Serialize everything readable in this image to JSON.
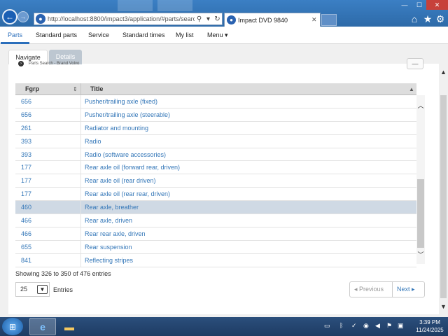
{
  "browser": {
    "url": "http://localhost:8800/impact3/application/#parts/searcl",
    "tab_title": "Impact DVD 9840",
    "tab_close": "✕",
    "back_icon": "arrow-left-icon",
    "search_glyph": "⚲",
    "refresh_glyph": "↻",
    "window_min": "—",
    "window_max": "☐",
    "window_close": "✕",
    "home_glyph": "⌂",
    "favorites_glyph": "★",
    "settings_glyph": "⚙"
  },
  "menu": {
    "items": [
      {
        "label": "Parts",
        "active": true
      },
      {
        "label": "Standard parts"
      },
      {
        "label": "Service"
      },
      {
        "label": "Standard times"
      },
      {
        "label": "My list"
      },
      {
        "label": "Menu ▾"
      }
    ]
  },
  "page_tabs": {
    "navigate": "Navigate",
    "details": "Details"
  },
  "breadcrumb": "Parts Search - Brand Volvo",
  "collapse_glyph": "—",
  "table": {
    "col1": "Fgrp",
    "col2": "Title",
    "rows": [
      {
        "fgrp": "656",
        "title": "Pusher/trailing axle (fixed)"
      },
      {
        "fgrp": "656",
        "title": "Pusher/trailing axle (steerable)"
      },
      {
        "fgrp": "261",
        "title": "Radiator and mounting"
      },
      {
        "fgrp": "393",
        "title": "Radio"
      },
      {
        "fgrp": "393",
        "title": "Radio (software accessories)"
      },
      {
        "fgrp": "177",
        "title": "Rear axle oil (forward rear, driven)"
      },
      {
        "fgrp": "177",
        "title": "Rear axle oil (rear driven)"
      },
      {
        "fgrp": "177",
        "title": "Rear axle oil (rear rear, driven)"
      },
      {
        "fgrp": "460",
        "title": "Rear axle, breather",
        "selected": true
      },
      {
        "fgrp": "466",
        "title": "Rear axle, driven"
      },
      {
        "fgrp": "466",
        "title": "Rear rear axle, driven"
      },
      {
        "fgrp": "655",
        "title": "Rear suspension"
      },
      {
        "fgrp": "841",
        "title": "Reflecting stripes"
      }
    ]
  },
  "showing": "Showing 326 to 350 of 476 entries",
  "page_size": "25",
  "entries_label": "Entries",
  "pager": {
    "previous": "◂ Previous",
    "next": "Next ▸"
  },
  "taskbar": {
    "time": "3:39 PM",
    "date": "11/24/2025"
  }
}
